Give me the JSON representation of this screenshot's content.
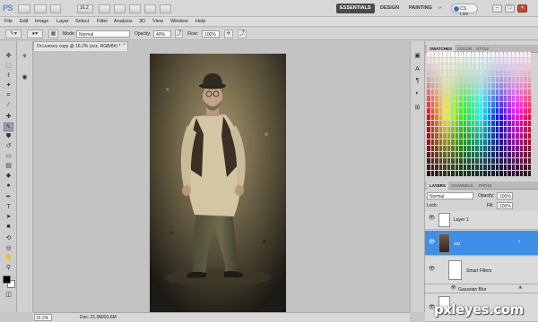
{
  "app": {
    "logo": "PS",
    "zoom": "16.2",
    "workspaces": [
      "ESSENTIALS",
      "DESIGN",
      "PAINTING",
      "»"
    ],
    "cslive": "CS Live"
  },
  "menu": [
    "File",
    "Edit",
    "Image",
    "Layer",
    "Select",
    "Filter",
    "Analysis",
    "3D",
    "View",
    "Window",
    "Help"
  ],
  "options": {
    "mode_label": "Mode:",
    "mode_value": "Normal",
    "opacity_label": "Opacity:",
    "opacity_value": "40%",
    "flow_label": "Flow:",
    "flow_value": "100%"
  },
  "document": {
    "tab_title": "Dr.Livesey copy @ 16.2% (zzz, RGB/8#) *",
    "close": "×",
    "zoom_field": "16.2%",
    "doc_size": "Doc: 21.0M/91.6M"
  },
  "panels": {
    "top_tabs": [
      "SWATCHES",
      "COLOR",
      "STYLE"
    ],
    "layer_tabs": [
      "LAYERS",
      "CHANNELS",
      "PATHS"
    ],
    "blend_mode": "Normal",
    "opacity_label": "Opacity:",
    "opacity_value": "100%",
    "lock_label": "Lock:",
    "fill_label": "Fill:",
    "fill_value": "100%",
    "layers": [
      "Layer 1",
      "zzz",
      "Smart Filters",
      "Gaussian Blur",
      ""
    ]
  },
  "watermark": "pxleyes.com",
  "colors": {
    "accent": "#3f8ee8",
    "workspace_active": "#4a4a4a"
  }
}
